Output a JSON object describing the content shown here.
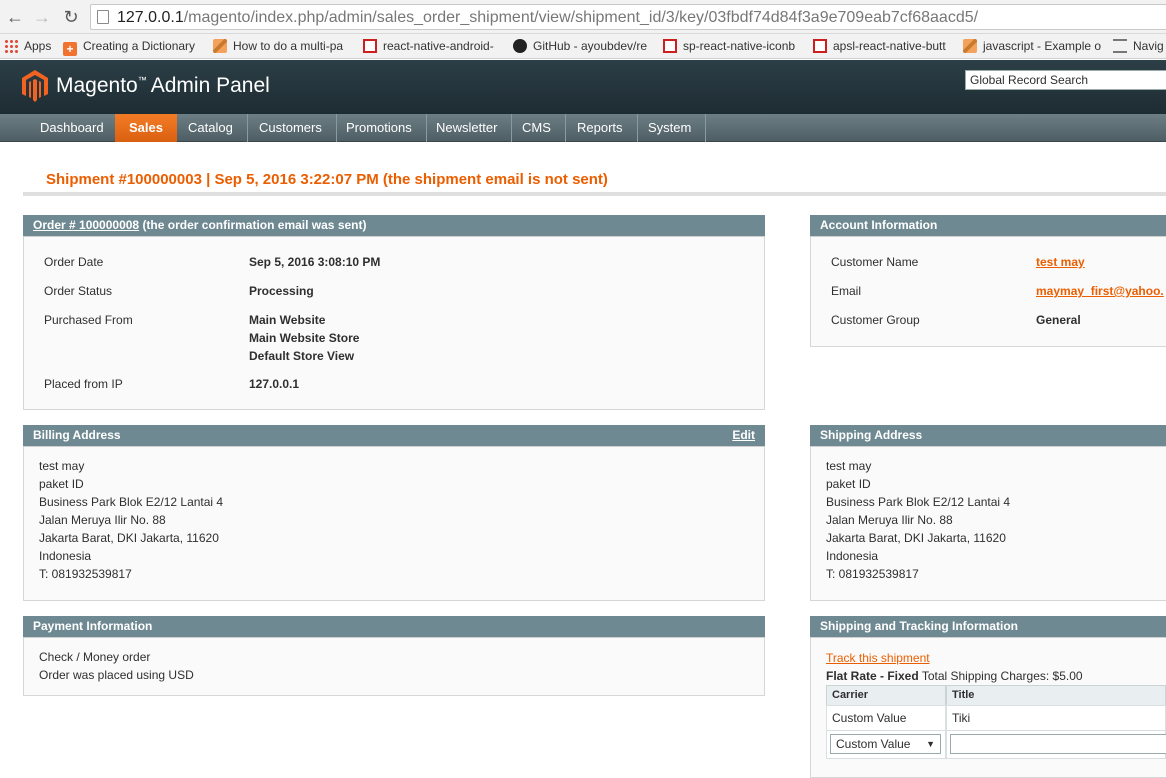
{
  "browser": {
    "url_host": "127.0.0.1",
    "url_path": "/magento/index.php/admin/sales_order_shipment/view/shipment_id/3/key/03fbdf74d84f3a9e709eab7cf68aacd5/",
    "bookmarks": [
      {
        "label": "Apps",
        "icon": "apps-icon"
      },
      {
        "label": "Creating a Dictionary",
        "icon": "plus-icon"
      },
      {
        "label": "How to do a multi-pa",
        "icon": "stack-icon"
      },
      {
        "label": "react-native-android-",
        "icon": "bookmark-icon"
      },
      {
        "label": "GitHub - ayoubdev/re",
        "icon": "github-icon"
      },
      {
        "label": "sp-react-native-iconb",
        "icon": "bookmark-icon"
      },
      {
        "label": "apsl-react-native-butt",
        "icon": "bookmark-icon"
      },
      {
        "label": "javascript - Example o",
        "icon": "stack-icon"
      },
      {
        "label": "Navig",
        "icon": "nav-icon"
      }
    ]
  },
  "header": {
    "title": "Magento",
    "trademark": "™",
    "subtitle": "Admin Panel",
    "search_value": "Global Record Search"
  },
  "nav": [
    "Dashboard",
    "Sales",
    "Catalog",
    "Customers",
    "Promotions",
    "Newsletter",
    "CMS",
    "Reports",
    "System"
  ],
  "nav_active": "Sales",
  "page_title": "Shipment #100000003 | Sep 5, 2016 3:22:07 PM (the shipment email is not sent)",
  "order": {
    "link": "Order # 100000008",
    "note": "(the order confirmation email was sent)",
    "fields": {
      "date_label": "Order Date",
      "date_value": "Sep 5, 2016 3:08:10 PM",
      "status_label": "Order Status",
      "status_value": "Processing",
      "purchased_label": "Purchased From",
      "purchased_1": "Main Website",
      "purchased_2": "Main Website Store",
      "purchased_3": "Default Store View",
      "ip_label": "Placed from IP",
      "ip_value": "127.0.0.1"
    }
  },
  "account": {
    "title": "Account Information",
    "name_label": "Customer Name",
    "name_value": "test may",
    "email_label": "Email",
    "email_value": "maymay_first@yahoo.",
    "group_label": "Customer Group",
    "group_value": "General"
  },
  "billing": {
    "title": "Billing Address",
    "edit": "Edit",
    "lines": [
      "test may",
      "paket ID",
      "Business Park Blok E2/12 Lantai 4",
      "Jalan Meruya Ilir No. 88",
      "Jakarta Barat, DKI Jakarta, 11620",
      "Indonesia",
      "T: 081932539817"
    ]
  },
  "shipping": {
    "title": "Shipping Address",
    "lines": [
      "test may",
      "paket ID",
      "Business Park Blok E2/12 Lantai 4",
      "Jalan Meruya Ilir No. 88",
      "Jakarta Barat, DKI Jakarta, 11620",
      "Indonesia",
      "T: 081932539817"
    ]
  },
  "payment": {
    "title": "Payment Information",
    "method": "Check / Money order",
    "currency": "Order was placed using USD"
  },
  "tracking": {
    "title": "Shipping and Tracking Information",
    "track_link": "Track this shipment",
    "method_bold": "Flat Rate - Fixed",
    "charges": "Total Shipping Charges: $5.00",
    "col_carrier": "Carrier",
    "col_title": "Title",
    "row_carrier": "Custom Value",
    "row_title": "Tiki",
    "select_value": "Custom Value"
  },
  "colors": {
    "accent": "#eb5e00",
    "box_header": "#6f8992",
    "header_bg": "#2c3e46"
  }
}
